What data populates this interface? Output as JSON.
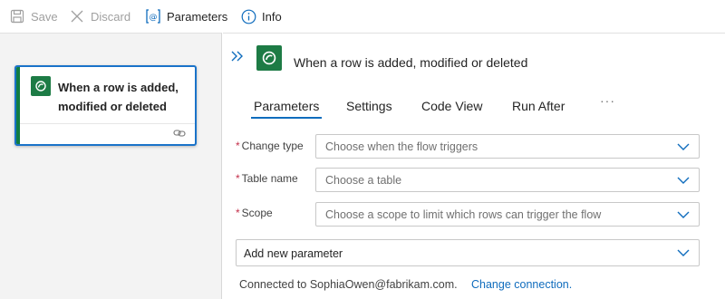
{
  "toolbar": {
    "save_label": "Save",
    "discard_label": "Discard",
    "parameters_label": "Parameters",
    "info_label": "Info"
  },
  "canvas": {
    "card": {
      "title": "When a row is added, modified or deleted",
      "icon": "dataverse-icon",
      "footer_icon": "link-icon"
    }
  },
  "panel": {
    "title": "When a row is added, modified or deleted",
    "tabs": [
      {
        "label": "Parameters",
        "active": true
      },
      {
        "label": "Settings",
        "active": false
      },
      {
        "label": "Code View",
        "active": false
      },
      {
        "label": "Run After",
        "active": false
      }
    ],
    "more_label": "···",
    "fields": [
      {
        "label": "Change type",
        "required": true,
        "placeholder": "Choose when the flow triggers"
      },
      {
        "label": "Table name",
        "required": true,
        "placeholder": "Choose a table"
      },
      {
        "label": "Scope",
        "required": true,
        "placeholder": "Choose a scope to limit which rows can trigger the flow"
      }
    ],
    "add_parameter_label": "Add new parameter",
    "connection_text": "Connected to SophiaOwen@fabrikam.com.",
    "change_connection_label": "Change connection."
  },
  "colors": {
    "accent": "#0f6cbd",
    "card_border": "#1a73c9",
    "connector": "#1d7b45",
    "required": "#c4314b"
  }
}
